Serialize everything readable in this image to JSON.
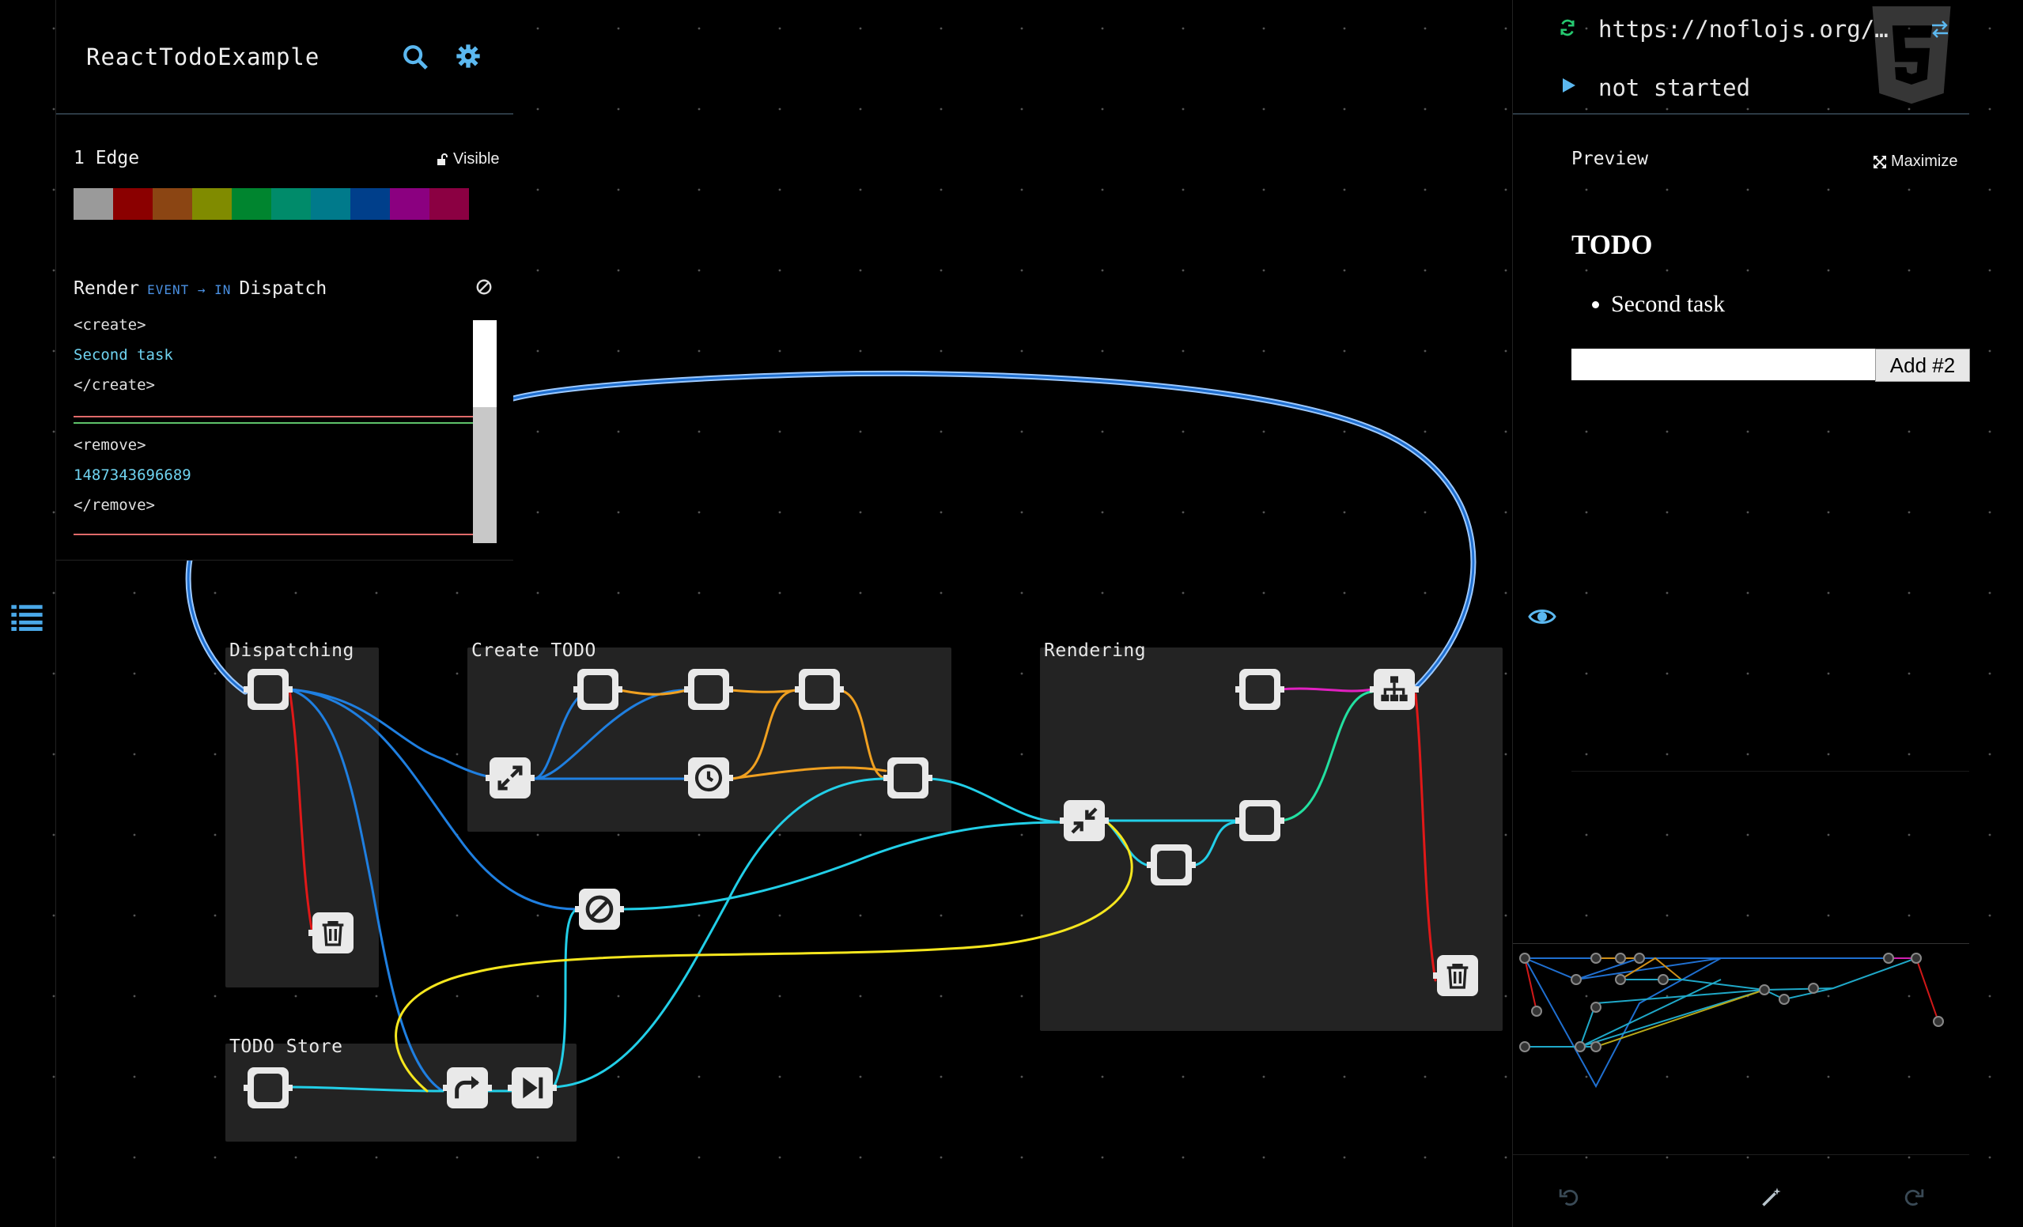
{
  "graph": {
    "title": "ReactTodoExample",
    "groups": [
      {
        "label": "Dispatching"
      },
      {
        "label": "Create TODO"
      },
      {
        "label": "Rendering"
      },
      {
        "label": "TODO Store"
      }
    ]
  },
  "edge_panel": {
    "count_label": "1 Edge",
    "visibility_label": "Visible",
    "colors": [
      "#9a9a9a",
      "#8b0000",
      "#8b4513",
      "#808b00",
      "#00852f",
      "#008b6a",
      "#007a8b",
      "#003f8b",
      "#8b0080",
      "#8b0042"
    ]
  },
  "packet_log": {
    "source": "Render",
    "route_label": "EVENT → IN",
    "target": "Dispatch",
    "lines": [
      {
        "text": "<create>",
        "kind": "tag"
      },
      {
        "text": "Second task",
        "kind": "val"
      },
      {
        "text": "</create>",
        "kind": "tag"
      },
      {
        "text": "<remove>",
        "kind": "tag"
      },
      {
        "text": "1487343696689",
        "kind": "val"
      },
      {
        "text": "</remove>",
        "kind": "tag"
      }
    ]
  },
  "runtime": {
    "url": "https://noflojs.org/…",
    "status": "not started"
  },
  "preview": {
    "label": "Preview",
    "maximize_label": "Maximize",
    "app_title": "TODO",
    "todos": [
      "Second task"
    ],
    "input_value": "",
    "add_button_label": "Add #2"
  },
  "icons": [
    "list-icon",
    "search-icon",
    "gear-icon",
    "lock-icon",
    "clear-icon",
    "refresh-icon",
    "swap-icon",
    "html5-logo",
    "play-icon",
    "maximize-icon",
    "eye-icon",
    "undo-icon",
    "wand-icon",
    "redo-icon",
    "trash-icon",
    "expand-icon",
    "compress-icon",
    "clock-icon",
    "block-icon",
    "share-icon",
    "skip-icon",
    "sitemap-icon"
  ],
  "colors": {
    "blue": "#1f7fe0",
    "cyan": "#22cfe8",
    "orange": "#f0a020",
    "yellow": "#f5e61e",
    "red": "#e01818",
    "magenta": "#e020c0",
    "green": "#22e0a0"
  }
}
